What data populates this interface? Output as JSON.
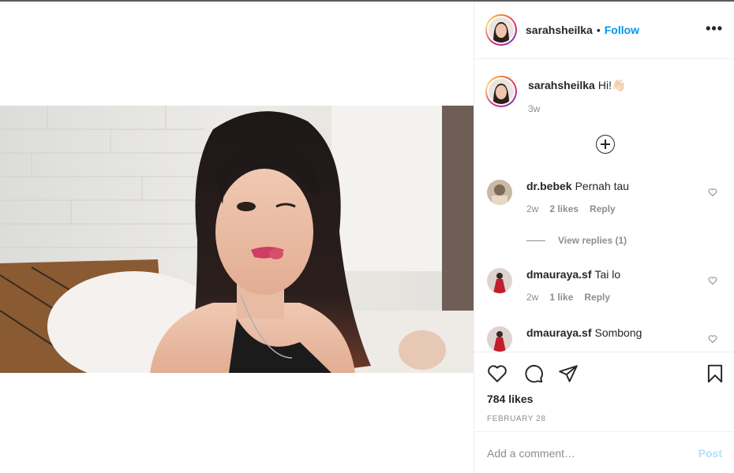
{
  "post": {
    "author": "sarahsheilka",
    "follow_label": "Follow",
    "dot": "•",
    "more_label": "•••",
    "photo_alt": "selfie-photo"
  },
  "caption": {
    "user": "sarahsheilka",
    "text": "Hi!👋🏻",
    "age": "3w"
  },
  "comments": [
    {
      "user": "dr.bebek",
      "text": "Pernah tau",
      "age": "2w",
      "likes": "2 likes",
      "reply_label": "Reply"
    },
    {
      "user": "dmauraya.sf",
      "text": "Tai lo",
      "age": "2w",
      "likes": "1 like",
      "reply_label": "Reply"
    },
    {
      "user": "dmauraya.sf",
      "text": "Sombong"
    }
  ],
  "replies_label": "View replies (1)",
  "actions": {
    "like_icon": "heart-icon",
    "comment_icon": "comment-icon",
    "share_icon": "paper-plane-icon",
    "save_icon": "bookmark-icon"
  },
  "likes_text": "784 likes",
  "date_text": "FEBRUARY 28",
  "add_comment": {
    "placeholder": "Add a comment…",
    "post_label": "Post"
  },
  "colors": {
    "accent": "#0095f6",
    "post_disabled": "#b2dffc",
    "muted": "#8e8e8e",
    "text": "#262626"
  }
}
